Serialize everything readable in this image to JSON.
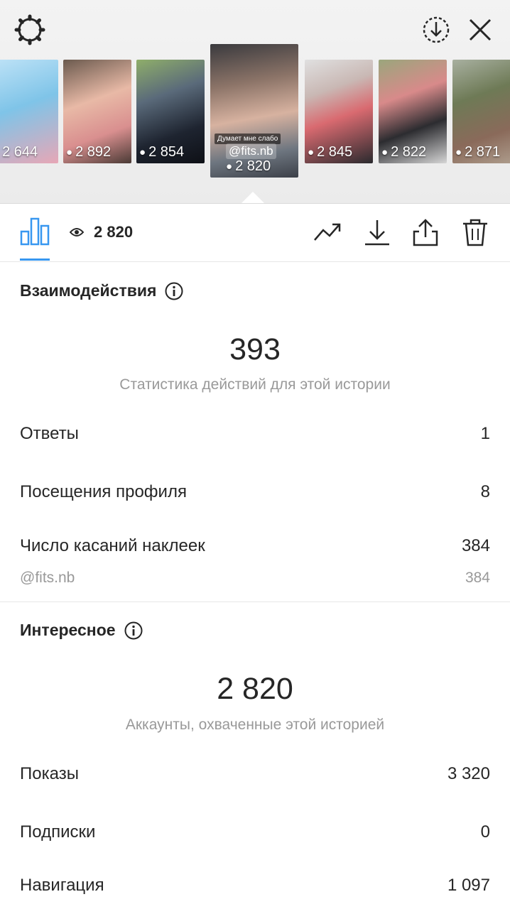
{
  "header": {
    "icons": [
      "settings-icon",
      "save-story-icon",
      "close-icon"
    ]
  },
  "stories": [
    {
      "views": "2 644"
    },
    {
      "views": "2 892"
    },
    {
      "views": "2 854"
    },
    {
      "views": "2 820",
      "caption": "Думает мне слабо",
      "sticker": "@fits.nb"
    },
    {
      "views": "2 845"
    },
    {
      "views": "2 822"
    },
    {
      "views": "2 871"
    }
  ],
  "toolbar": {
    "views": "2 820",
    "icons": [
      "insights-bar-chart-icon",
      "eye-icon",
      "trending-icon",
      "download-icon",
      "share-icon",
      "trash-icon"
    ]
  },
  "interactions": {
    "title": "Взаимодействия",
    "total": "393",
    "caption": "Статистика действий для этой истории",
    "rows": [
      {
        "label": "Ответы",
        "value": "1"
      },
      {
        "label": "Посещения профиля",
        "value": "8"
      },
      {
        "label": "Число касаний наклеек",
        "value": "384"
      }
    ],
    "sub_row": {
      "label": "@fits.nb",
      "value": "384"
    }
  },
  "discovery": {
    "title": "Интересное",
    "total": "2 820",
    "caption": "Аккаунты, охваченные этой историей",
    "rows": [
      {
        "label": "Показы",
        "value": "3 320"
      },
      {
        "label": "Подписки",
        "value": "0"
      },
      {
        "label": "Навигация",
        "value": "1 097"
      }
    ]
  },
  "colors": {
    "accent": "#3897f0",
    "text": "#262626",
    "secondary": "#999999"
  }
}
